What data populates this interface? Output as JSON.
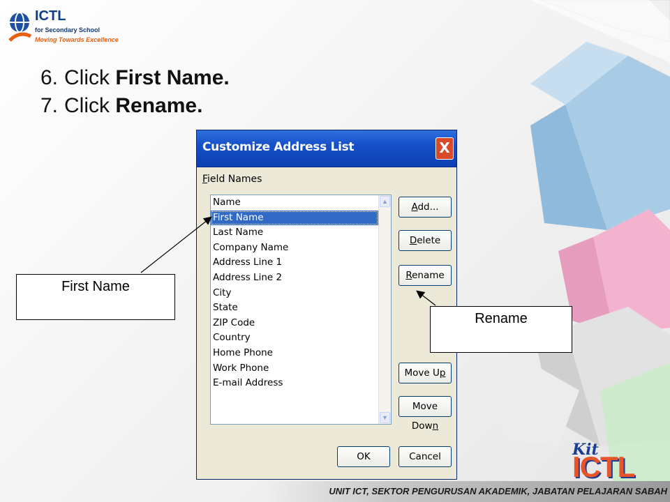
{
  "logo": {
    "name": "ICTL",
    "line1": "for Secondary School",
    "line2": "Moving Towards Excellence"
  },
  "steps": [
    {
      "num": "6.",
      "prefix": "Click ",
      "bold": "First Name."
    },
    {
      "num": "7.",
      "prefix": "Click ",
      "bold": "Rename."
    }
  ],
  "dialog": {
    "title": "Customize Address List",
    "close_label": "X",
    "field_names_label_accel": "F",
    "field_names_label_rest": "ield Names",
    "items": [
      "Name",
      "First Name",
      "Last Name",
      "Company Name",
      "Address Line 1",
      "Address Line 2",
      "City",
      "State",
      "ZIP Code",
      "Country",
      "Home Phone",
      "Work Phone",
      "E-mail Address"
    ],
    "selected_index": 1,
    "buttons": {
      "add": {
        "accel": "A",
        "rest": "dd..."
      },
      "delete": {
        "accel": "D",
        "rest": "elete"
      },
      "rename": {
        "accel": "R",
        "rest": "ename"
      },
      "move_up": {
        "pre": "Move U",
        "accel": "p",
        "rest": ""
      },
      "move_down": {
        "pre": "Move Dow",
        "accel": "n",
        "rest": ""
      },
      "ok": "OK",
      "cancel": "Cancel"
    }
  },
  "callouts": {
    "first_name": "First Name",
    "rename": "Rename"
  },
  "footer": "UNIT ICT, SEKTOR PENGURUSAN AKADEMIK, JABATAN PELAJARAN SABAH",
  "kit_logo": {
    "kit": "Kit",
    "ictl": "ICTL"
  }
}
